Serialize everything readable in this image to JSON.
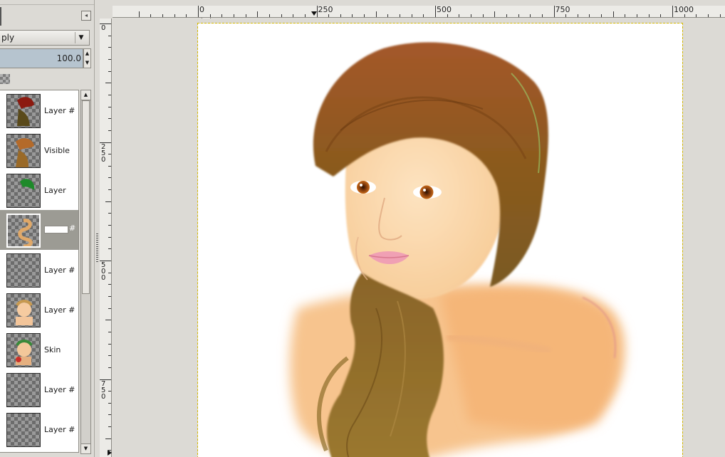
{
  "layers_dock": {
    "mode_label": "ply",
    "mode_arrow": "▼",
    "opacity_value": "100.0",
    "dock_menu_glyph": "◂",
    "layers": [
      {
        "name": "Layer #",
        "thumb": "red-hair"
      },
      {
        "name": "Visible",
        "thumb": "brown-hair"
      },
      {
        "name": "Layer",
        "thumb": "green-hair"
      },
      {
        "name": "#",
        "thumb": "curl",
        "selected": true,
        "editing": true
      },
      {
        "name": "Layer #",
        "thumb": "empty"
      },
      {
        "name": "Layer #",
        "thumb": "face"
      },
      {
        "name": "Skin",
        "thumb": "skin"
      },
      {
        "name": "Layer #",
        "thumb": "empty"
      },
      {
        "name": "Layer #",
        "thumb": "empty"
      }
    ]
  },
  "rulers": {
    "nav_glyph": "▸",
    "h_labels": [
      "0",
      "250",
      "500",
      "750",
      "1000"
    ],
    "v_labels": [
      "0",
      "250",
      "500",
      "750"
    ]
  },
  "colors": {
    "selection_row": "#9c9b94",
    "opacity_fill": "#b6c4cf",
    "canvas_bg": "#ffffff",
    "dock_bg": "#dcdad5",
    "hair": "#8b5a1e",
    "skin": "#fcdcb4",
    "lips": "#f0a0b4"
  }
}
